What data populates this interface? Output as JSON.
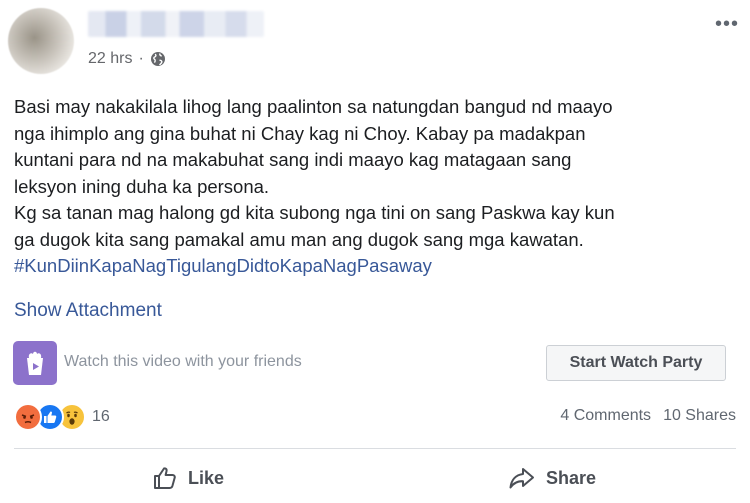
{
  "header": {
    "timestamp": "22 hrs",
    "separator": "·",
    "audience_icon": "globe-icon",
    "more_icon": "more-options-icon",
    "more_label": "•••"
  },
  "post": {
    "lines": [
      "Basi may nakakilala lihog lang paalinton sa natungdan bangud nd maayo",
      "nga ihimplo ang gina buhat ni Chay kag ni Choy. Kabay pa madakpan",
      "kuntani para nd na makabuhat sang indi maayo kag matagaan sang",
      "leksyon ining duha ka persona.",
      "Kg sa tanan mag halong gd kita subong nga tini on sang Paskwa kay kun",
      "ga dugok kita sang pamakal amu man ang dugok sang mga kawatan."
    ],
    "hashtag": "#KunDiinKapaNagTigulangDidtoKapaNagPasaway",
    "show_attachment": "Show Attachment"
  },
  "watch_party": {
    "text": "Watch this video with your friends",
    "button_label": "Start Watch Party",
    "icon": "watch-party-icon",
    "icon_color": "#8c72cb"
  },
  "engagement": {
    "reactions": [
      "angry",
      "like",
      "wow"
    ],
    "reaction_count": "16",
    "comments": "4 Comments",
    "shares": "10 Shares"
  },
  "actions": {
    "like_label": "Like",
    "share_label": "Share"
  },
  "colors": {
    "link": "#385898",
    "text": "#1c1e21",
    "muted": "#606770"
  }
}
